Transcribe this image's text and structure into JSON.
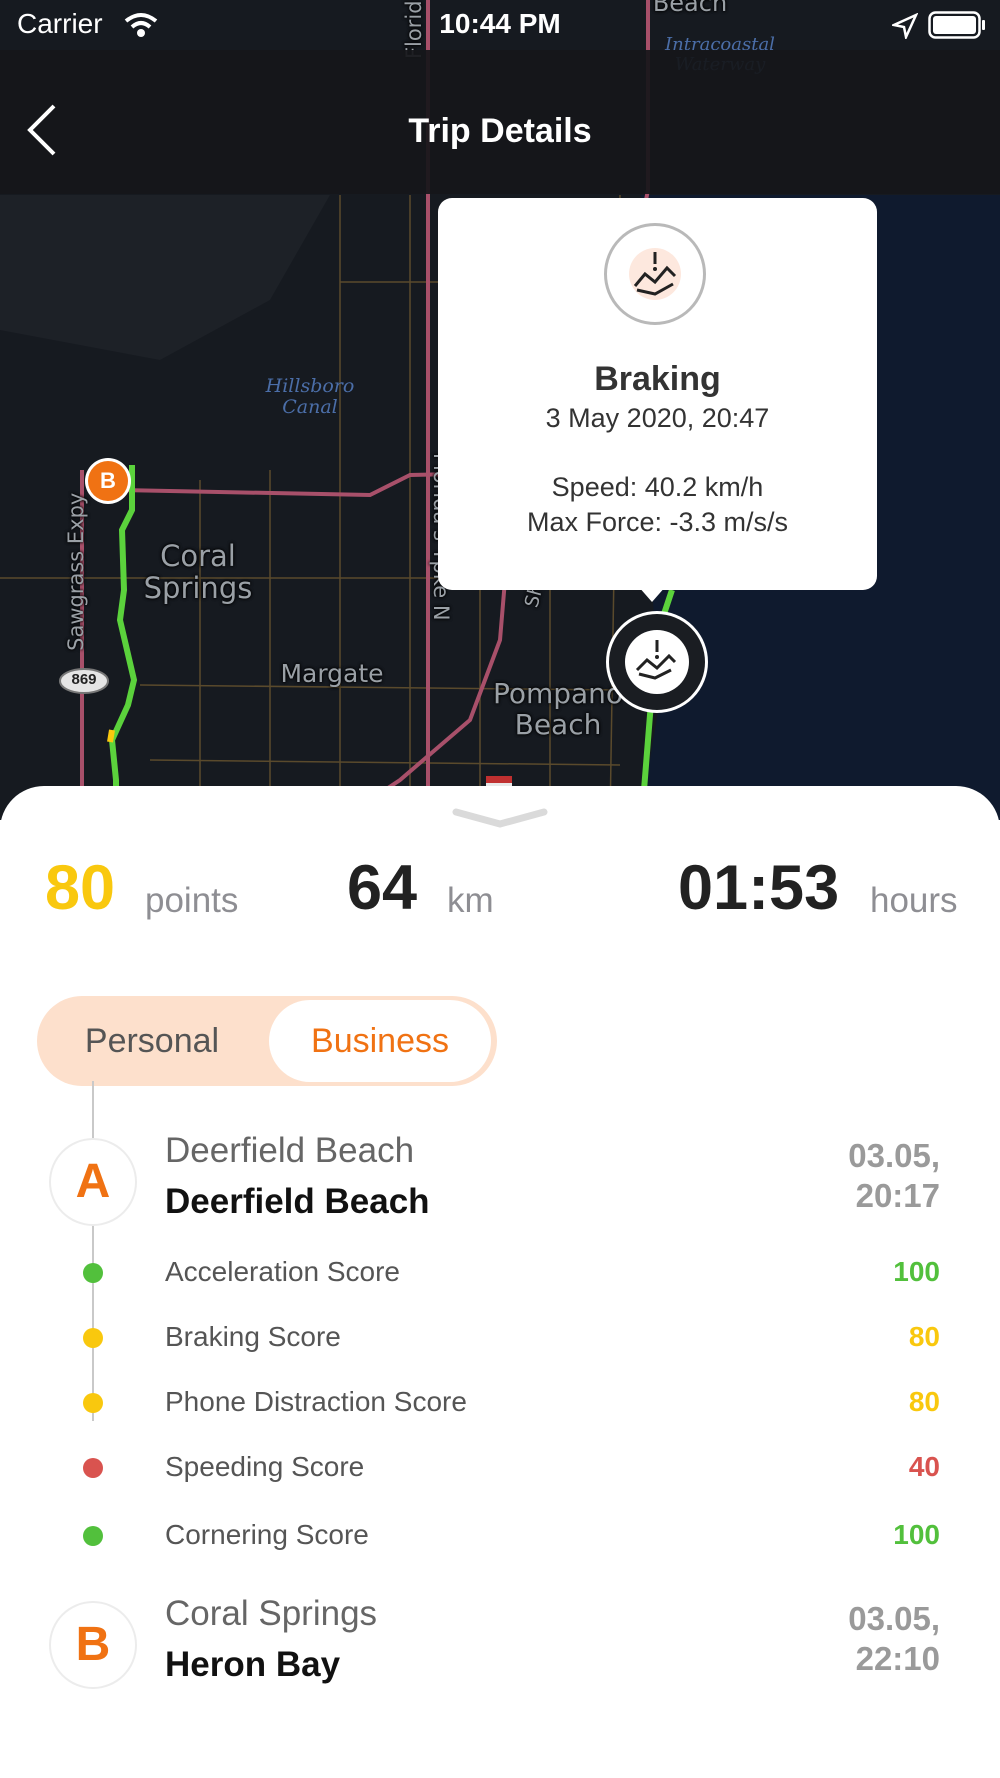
{
  "status_bar": {
    "carrier": "Carrier",
    "time": "10:44 PM"
  },
  "nav": {
    "title": "Trip Details",
    "back_icon": "chevron-left-icon"
  },
  "map": {
    "labels": {
      "coral_springs": "Coral\nSprings",
      "margate": "Margate",
      "pompano_beach": "Pompano\nBeach",
      "hillsboro_canal": "Hillsboro\nCanal",
      "intracoastal": "Intracoastal\nWaterway",
      "sawgrass": "Sawgrass Expy",
      "florida_tpke": "Florida's Tpke N",
      "florida_top": "Florid",
      "beach_top": "Beach",
      "sr_partial": "Sh",
      "shield_869": "869"
    },
    "end_marker": "B",
    "event_icon": "hard-braking-icon",
    "colors": {
      "route": "#5bd23c",
      "highway": "#a8506a",
      "marker": "#f07213"
    }
  },
  "popup": {
    "icon": "hard-braking-icon",
    "title": "Braking",
    "date": "3 May 2020, 20:47",
    "speed": "Speed: 40.2 km/h",
    "force": "Max Force: -3.3 m/s/s"
  },
  "summary": {
    "points_value": "80",
    "points_unit": "points",
    "distance_value": "64",
    "distance_unit": "km",
    "duration_value": "01:53",
    "duration_unit": "hours",
    "colors": {
      "points": "#f9c80e",
      "text": "#222222"
    }
  },
  "trip_type": {
    "options": [
      "Personal",
      "Business"
    ],
    "selected": "Business"
  },
  "start": {
    "marker": "A",
    "line1": "Deerfield Beach",
    "line2": "Deerfield Beach",
    "date": "03.05,",
    "time": "20:17"
  },
  "end": {
    "marker": "B",
    "line1": "Coral Springs",
    "line2": "Heron Bay",
    "date": "03.05,",
    "time": "22:10"
  },
  "scores": [
    {
      "label": "Acceleration Score",
      "value": "100",
      "color": "#52c03c"
    },
    {
      "label": "Braking Score",
      "value": "80",
      "color": "#f9c80e"
    },
    {
      "label": "Phone Distraction Score",
      "value": "80",
      "color": "#f9c80e"
    },
    {
      "label": "Speeding Score",
      "value": "40",
      "color": "#d9534f"
    },
    {
      "label": "Cornering Score",
      "value": "100",
      "color": "#52c03c"
    }
  ]
}
